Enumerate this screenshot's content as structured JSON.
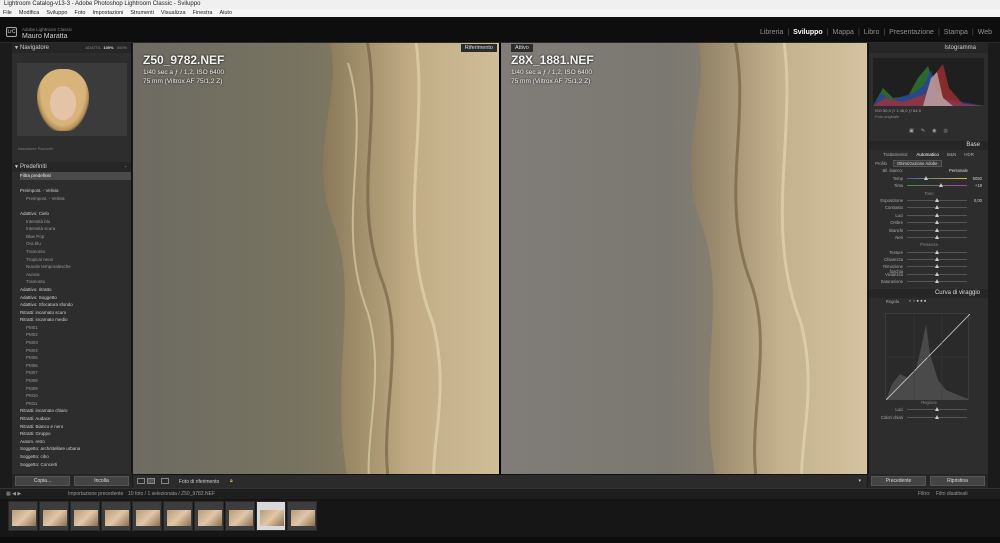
{
  "window": {
    "title": "Lightroom Catalog-v13-3 - Adobe Photoshop Lightroom Classic - Sviluppo"
  },
  "menu": [
    "File",
    "Modifica",
    "Sviluppo",
    "Foto",
    "Impostazioni",
    "Strumenti",
    "Visualizza",
    "Finestra",
    "Aiuto"
  ],
  "identity": {
    "logo": "LrC",
    "subtitle": "Adobe Lightroom Classic",
    "user": "Mauro Maratta"
  },
  "modules": [
    "Libreria",
    "Sviluppo",
    "Mappa",
    "Libro",
    "Presentazione",
    "Stampa",
    "Web"
  ],
  "active_module": "Sviluppo",
  "navigator": {
    "title": "Navigatore",
    "zoom_options": [
      "ADATTA",
      "100%",
      "300%"
    ],
    "active_zoom": "100%"
  },
  "left_misc": {
    "line1": "Istantanee   Raccolte"
  },
  "presets": {
    "title": "Predefiniti",
    "items": [
      {
        "text": "Filtra predefiniti",
        "cls": "sel"
      },
      {
        "text": "",
        "cls": ""
      },
      {
        "text": "Preimpost. - Velivia",
        "cls": "hdr"
      },
      {
        "text": "Preimpost. - Velivia",
        "cls": "sub"
      },
      {
        "text": "",
        "cls": ""
      },
      {
        "text": "Adattivo: Cielo",
        "cls": "hdr"
      },
      {
        "text": "Intensità blu",
        "cls": "sub"
      },
      {
        "text": "Intensità scura",
        "cls": "sub"
      },
      {
        "text": "Blue Pop",
        "cls": "sub"
      },
      {
        "text": "Ora blu",
        "cls": "sub"
      },
      {
        "text": "Tramonto",
        "cls": "sub"
      },
      {
        "text": "Tropical neon",
        "cls": "sub"
      },
      {
        "text": "Nuvole temporalesche",
        "cls": "sub"
      },
      {
        "text": "Aurora",
        "cls": "sub"
      },
      {
        "text": "Tramonto",
        "cls": "sub"
      },
      {
        "text": "Adattivo: ritratto",
        "cls": "hdr"
      },
      {
        "text": "Adattivo: Soggetto",
        "cls": "hdr"
      },
      {
        "text": "Adattivo: Sfocatura sfondo",
        "cls": "hdr"
      },
      {
        "text": "Ritratti: incarnato scuro",
        "cls": "hdr"
      },
      {
        "text": "Ritratti: incarnato medio",
        "cls": "hdr"
      },
      {
        "text": "PM01",
        "cls": "sub"
      },
      {
        "text": "PM02",
        "cls": "sub"
      },
      {
        "text": "PM03",
        "cls": "sub"
      },
      {
        "text": "PM04",
        "cls": "sub"
      },
      {
        "text": "PM05",
        "cls": "sub"
      },
      {
        "text": "PM06",
        "cls": "sub"
      },
      {
        "text": "PM07",
        "cls": "sub"
      },
      {
        "text": "PM08",
        "cls": "sub"
      },
      {
        "text": "PM09",
        "cls": "sub"
      },
      {
        "text": "PM10",
        "cls": "sub"
      },
      {
        "text": "PM11",
        "cls": "sub"
      },
      {
        "text": "Ritratti: incarnato chiaro",
        "cls": "hdr"
      },
      {
        "text": "Ritratti: Audace",
        "cls": "hdr"
      },
      {
        "text": "Ritratti: Bianco e nero",
        "cls": "hdr"
      },
      {
        "text": "Ritratti: Gruppo",
        "cls": "hdr"
      },
      {
        "text": "Autom. retro",
        "cls": "hdr"
      },
      {
        "text": "Soggetto: arch/stellare urbana",
        "cls": "hdr"
      },
      {
        "text": "Soggetto: cibo",
        "cls": "hdr"
      },
      {
        "text": "Soggetto: Concerti",
        "cls": "hdr"
      }
    ]
  },
  "left_buttons": {
    "copy": "Copia...",
    "paste": "Incolla"
  },
  "compare": {
    "ref_label": "Riferimento",
    "active_label": "Attivo",
    "left_name": "Z50_9782.NEF",
    "left_meta1": "1/40 sec a ƒ / 1,2, ISO 6400",
    "left_meta2": "75 mm (Viltrox AF 75/1,2 Z)",
    "right_name": "Z8X_1881.NEF",
    "right_meta1": "1/40 sec a ƒ / 1,2, ISO 6400",
    "right_meta2": "75 mm (Viltrox AF 75/1,2 Z)"
  },
  "toolbar": {
    "ref_photo": "Foto di riferimento"
  },
  "right": {
    "histogram_title": "Istogramma",
    "hist_info": "ISO  50,0  ƒ/ 1  46,0  ƒ/   64,5",
    "foto_check": "Foto originale",
    "base_title": "Base",
    "treatment": [
      "Trattamento:",
      "Automatico",
      "B&N",
      "HDR"
    ],
    "profile_label": "Profilo",
    "profile_value": "Ottimizzazione Adobe",
    "wb_label": "Bil. bianco:",
    "wb_value": "Personale",
    "temp": {
      "label": "Temp",
      "value": "5050"
    },
    "tint": {
      "label": "Tinta",
      "value": "+18"
    },
    "tone_title": "Tono",
    "tone_rows": [
      "Esposizione",
      "Contrasto",
      "Luci",
      "Ombre",
      "Bianchi",
      "Neri"
    ],
    "exposure_value": "0,00",
    "presence_title": "Presenza",
    "presence_rows": [
      "Texture",
      "Chiarezza",
      "Rimozione foschia",
      "Vividezza",
      "Saturazione"
    ],
    "curve_title": "Curva di viraggio",
    "curve_ctrl": "Regola",
    "region_title": "Regione",
    "region_rows": [
      "Luci",
      "Colori chiari"
    ]
  },
  "right_buttons": {
    "previous": "Precedente",
    "reset": "Ripristina"
  },
  "filmbar": {
    "source": "Importazione precedente",
    "count": "10 foto / 1 selezionata / Z50_9782.NEF",
    "filter_label": "Filtro:",
    "filter_value": "Filtri disattivati"
  },
  "filmstrip": {
    "count": 10,
    "selected": 8
  }
}
